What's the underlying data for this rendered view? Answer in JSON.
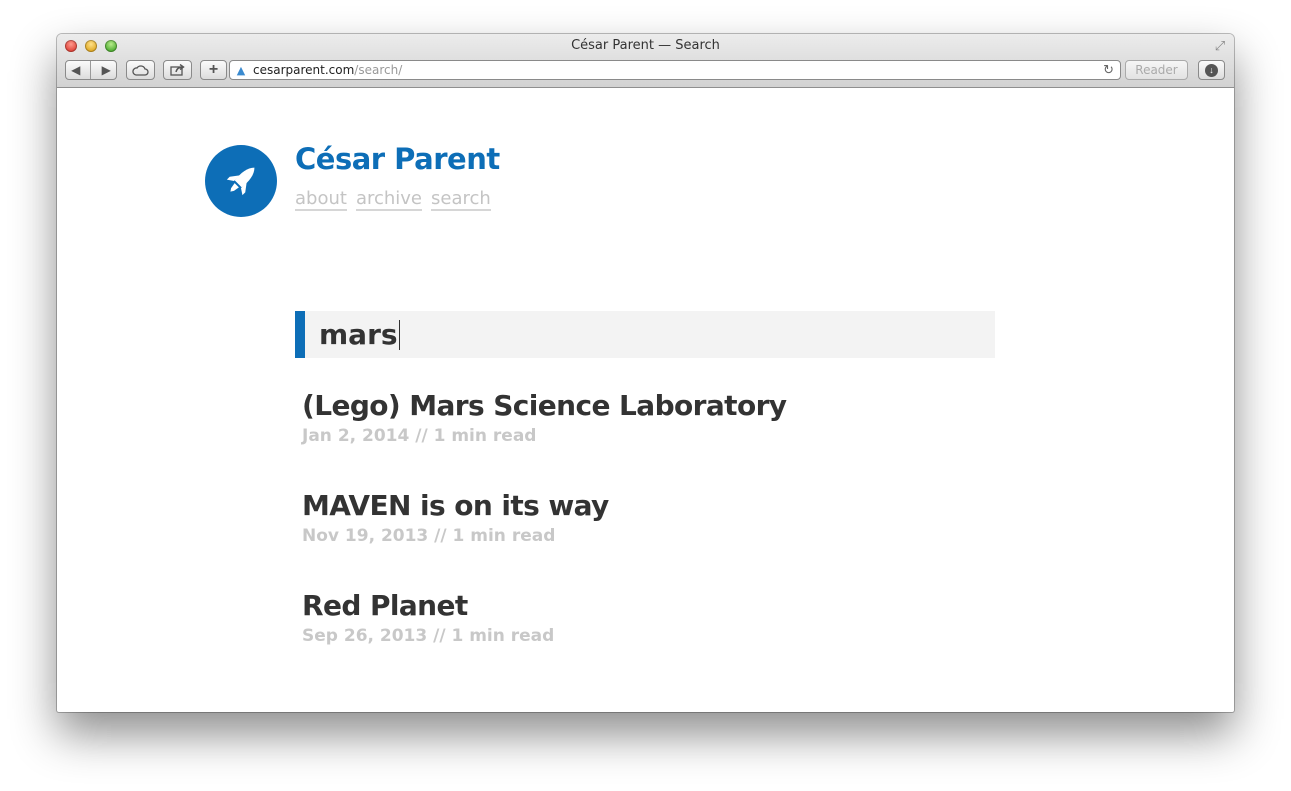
{
  "window": {
    "title": "César Parent — Search"
  },
  "toolbar": {
    "url_domain": "cesarparent.com",
    "url_path": "/search/",
    "reader_label": "Reader",
    "back_icon": "back-arrow-icon",
    "forward_icon": "forward-arrow-icon",
    "cloud_icon": "cloud-icon",
    "share_icon": "share-icon",
    "add_icon": "plus-icon",
    "reload_icon": "reload-icon",
    "download_icon": "download-icon"
  },
  "site": {
    "title": "César Parent",
    "logo_icon": "rocket-icon",
    "brand_color": "#0d6eb7",
    "nav": [
      "about",
      "archive",
      "search"
    ]
  },
  "search": {
    "query": "mars"
  },
  "results": [
    {
      "title": "(Lego) Mars Science Laboratory",
      "meta": "Jan 2, 2014 // 1 min read"
    },
    {
      "title": "MAVEN is on its way",
      "meta": "Nov 19, 2013 // 1 min read"
    },
    {
      "title": "Red Planet",
      "meta": "Sep 26, 2013 // 1 min read"
    }
  ]
}
